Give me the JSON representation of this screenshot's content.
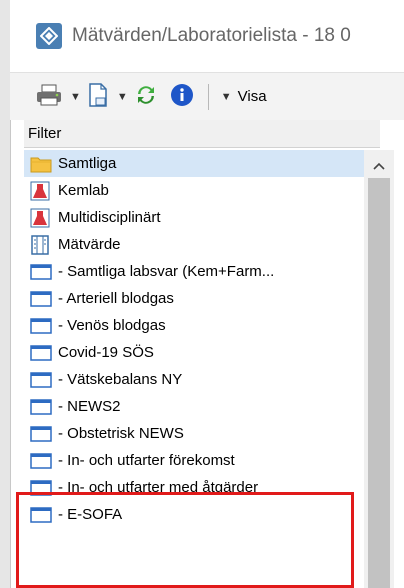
{
  "window": {
    "title": "Mätvärden/Laboratorielista - 18 0",
    "accent": "#4a7fb3"
  },
  "toolbar": {
    "print_icon": "printer-icon",
    "document_icon": "document-icon",
    "refresh_icon": "refresh-icon",
    "info_icon": "info-icon",
    "view_label": "Visa"
  },
  "filter": {
    "header": "Filter",
    "items": [
      {
        "label": "Samtliga",
        "icon": "folder-icon",
        "selected": true
      },
      {
        "label": "Kemlab",
        "icon": "lab-flask-icon",
        "selected": false
      },
      {
        "label": "Multidisciplinärt",
        "icon": "lab-flask-icon",
        "selected": false
      },
      {
        "label": "Mätvärde",
        "icon": "chart-list-icon",
        "selected": false
      },
      {
        "label": "- Samtliga labsvar (Kem+Farm...",
        "icon": "window-icon",
        "selected": false
      },
      {
        "label": "- Arteriell blodgas",
        "icon": "window-icon",
        "selected": false
      },
      {
        "label": "- Venös blodgas",
        "icon": "window-icon",
        "selected": false
      },
      {
        "label": "Covid-19 SÖS",
        "icon": "window-icon",
        "selected": false
      },
      {
        "label": "- Vätskebalans NY",
        "icon": "window-icon",
        "selected": false
      },
      {
        "label": "- NEWS2",
        "icon": "window-icon",
        "selected": false
      },
      {
        "label": "- Obstetrisk NEWS",
        "icon": "window-icon",
        "selected": false
      },
      {
        "label": "- In- och utfarter förekomst",
        "icon": "window-icon",
        "selected": false
      },
      {
        "label": "- In- och utfarter med åtgärder",
        "icon": "window-icon",
        "selected": false
      },
      {
        "label": "- E-SOFA",
        "icon": "window-icon",
        "selected": false
      }
    ]
  },
  "annotation": {
    "color": "#e11a1a"
  }
}
